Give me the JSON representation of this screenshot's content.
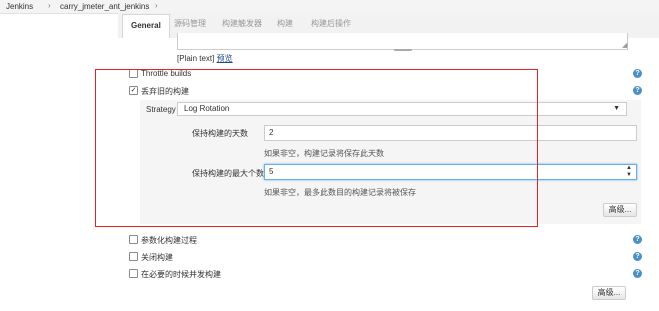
{
  "breadcrumb": {
    "root": "Jenkins",
    "job": "carry_jmeter_ant_jenkins"
  },
  "tabs": [
    "General",
    "源码管理",
    "构建触发器",
    "构建",
    "构建后操作"
  ],
  "editor": {
    "format_text": "[Plain text]",
    "preview_link": "预览"
  },
  "options": {
    "throttle": {
      "label": "Throttle builds",
      "checked": false
    },
    "discard": {
      "label": "丢弃旧的构建",
      "checked": true
    },
    "parameterized": {
      "label": "参数化构建过程",
      "checked": false
    },
    "disable": {
      "label": "关闭构建",
      "checked": false
    },
    "concurrent": {
      "label": "在必要的时候并发构建",
      "checked": false
    }
  },
  "strategy": {
    "label": "Strategy",
    "value": "Log Rotation",
    "days_label": "保持构建的天数",
    "days_value": "2",
    "days_note": "如果非空，构建记录将保存此天数",
    "max_label": "保持构建的最大个数",
    "max_value": "5",
    "max_note": "如果非空，最多此数目的构建记录将被保存",
    "advanced": "高级..."
  },
  "footer_advanced": "高级...",
  "colors": {
    "highlight": "#e02424",
    "help": "#4a90c8"
  }
}
